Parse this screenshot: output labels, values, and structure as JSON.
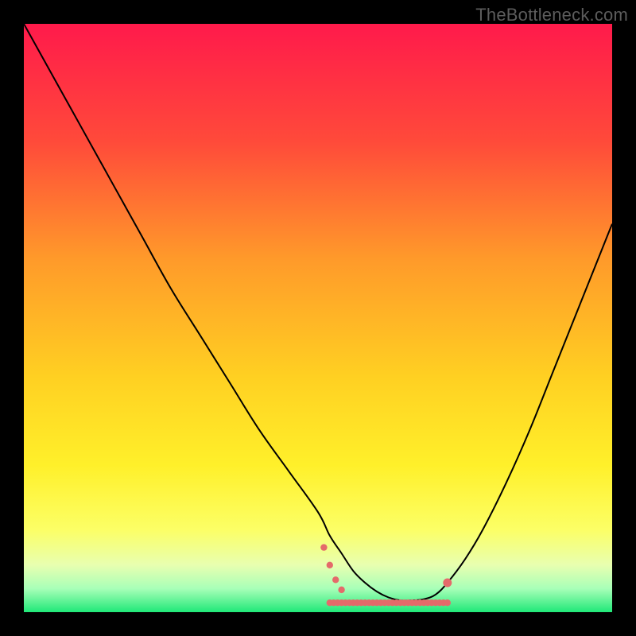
{
  "watermark": "TheBottleneck.com",
  "chart_data": {
    "type": "line",
    "title": "",
    "xlabel": "",
    "ylabel": "",
    "xlim": [
      0,
      100
    ],
    "ylim": [
      0,
      100
    ],
    "background_gradient": {
      "stops": [
        {
          "offset": 0,
          "color": "#ff1a4b"
        },
        {
          "offset": 20,
          "color": "#ff4a3a"
        },
        {
          "offset": 40,
          "color": "#ff9a2a"
        },
        {
          "offset": 60,
          "color": "#ffd022"
        },
        {
          "offset": 75,
          "color": "#fff02a"
        },
        {
          "offset": 86,
          "color": "#fcff66"
        },
        {
          "offset": 92,
          "color": "#e8ffb0"
        },
        {
          "offset": 96,
          "color": "#a8ffb8"
        },
        {
          "offset": 100,
          "color": "#20e878"
        }
      ]
    },
    "series": [
      {
        "name": "bottleneck-curve",
        "color": "#000000",
        "x": [
          0,
          5,
          10,
          15,
          20,
          25,
          30,
          35,
          40,
          45,
          50,
          52,
          54,
          56,
          58,
          60,
          62,
          64,
          66,
          68,
          70,
          72,
          75,
          78,
          82,
          86,
          90,
          94,
          98,
          100
        ],
        "y": [
          100,
          91,
          82,
          73,
          64,
          55,
          47,
          39,
          31,
          24,
          17,
          13,
          10,
          7,
          5,
          3.5,
          2.5,
          2,
          2,
          2.2,
          3,
          5,
          9,
          14,
          22,
          31,
          41,
          51,
          61,
          66
        ]
      }
    ],
    "flat_segment": {
      "comment": "coral dotted markers along valley floor",
      "color": "#e46a6a",
      "x_start": 52,
      "x_end": 72,
      "y": 2,
      "endpoint_right": {
        "x": 72,
        "y": 5
      }
    }
  }
}
